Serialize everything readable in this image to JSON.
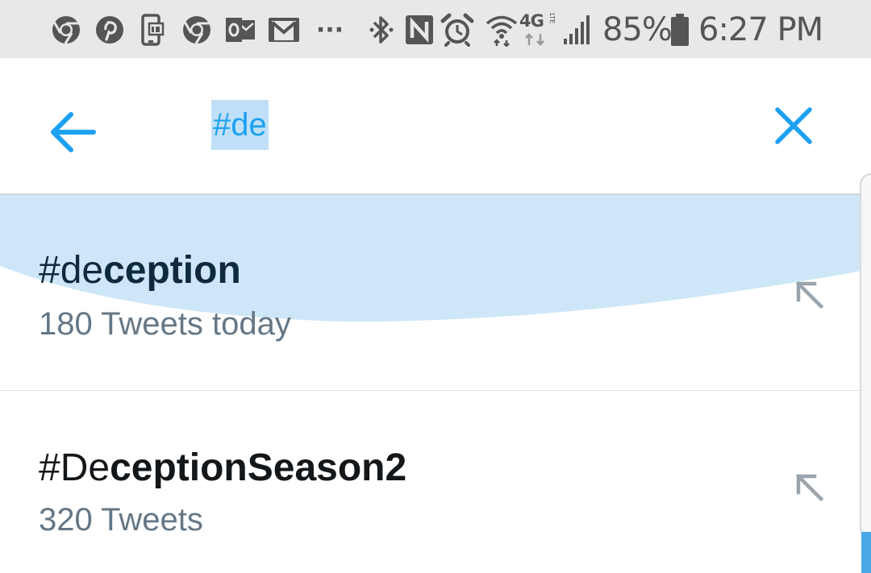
{
  "status_bar": {
    "icons": [
      "chrome-icon",
      "pinterest-icon",
      "caller-id-icon",
      "chrome-icon",
      "outlook-icon",
      "gmail-icon",
      "more-dots-icon",
      "bluetooth-icon",
      "nfc-icon",
      "alarm-icon",
      "wifi-icon",
      "4g-lte-icon",
      "signal-icon",
      "battery-icon"
    ],
    "more": "···",
    "network": "4G",
    "network_sub": "LTE",
    "battery": "85%",
    "time": "6:27 PM"
  },
  "search": {
    "query": "#de"
  },
  "suggestions": [
    {
      "typed": "#de",
      "rest": "ception",
      "count": "180 Tweets today"
    },
    {
      "typed": "#De",
      "rest": "ceptionSeason2",
      "count": "320 Tweets"
    }
  ],
  "colors": {
    "accent": "#1da1f2",
    "selection": "#bfe0f8",
    "ripple": "#cde7f8",
    "secondary_text": "#657786",
    "status_bar_bg": "#e8e8e8"
  }
}
